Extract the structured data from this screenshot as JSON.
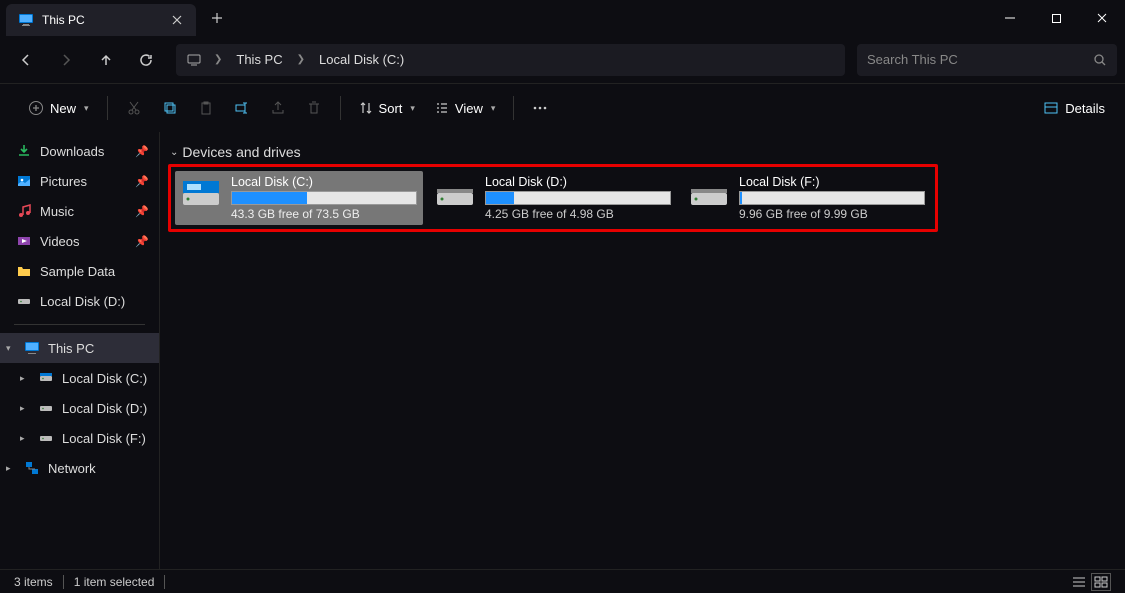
{
  "tab": {
    "title": "This PC"
  },
  "breadcrumb": {
    "items": [
      "This PC",
      "Local Disk (C:)"
    ]
  },
  "search": {
    "placeholder": "Search This PC"
  },
  "toolbar": {
    "new": "New",
    "sort": "Sort",
    "view": "View",
    "details": "Details"
  },
  "sidebar": {
    "quick": [
      {
        "label": "Downloads",
        "icon": "downloads",
        "pinned": true
      },
      {
        "label": "Pictures",
        "icon": "pictures",
        "pinned": true
      },
      {
        "label": "Music",
        "icon": "music",
        "pinned": true
      },
      {
        "label": "Videos",
        "icon": "videos",
        "pinned": true
      },
      {
        "label": "Sample Data",
        "icon": "folder",
        "pinned": false
      },
      {
        "label": "Local Disk (D:)",
        "icon": "drive",
        "pinned": false
      }
    ],
    "tree": [
      {
        "label": "This PC",
        "icon": "thispc",
        "selected": true,
        "children": [
          {
            "label": "Local Disk (C:)",
            "icon": "drive"
          },
          {
            "label": "Local Disk (D:)",
            "icon": "drive"
          },
          {
            "label": "Local Disk (F:)",
            "icon": "drive"
          }
        ]
      },
      {
        "label": "Network",
        "icon": "network"
      }
    ]
  },
  "main": {
    "group": "Devices and drives",
    "drives": [
      {
        "name": "Local Disk (C:)",
        "free": "43.3 GB free of 73.5 GB",
        "fill": 41,
        "selected": true
      },
      {
        "name": "Local Disk (D:)",
        "free": "4.25 GB free of 4.98 GB",
        "fill": 15,
        "selected": false
      },
      {
        "name": "Local Disk (F:)",
        "free": "9.96 GB free of 9.99 GB",
        "fill": 1,
        "selected": false
      }
    ]
  },
  "status": {
    "items": "3 items",
    "selected": "1 item selected"
  }
}
